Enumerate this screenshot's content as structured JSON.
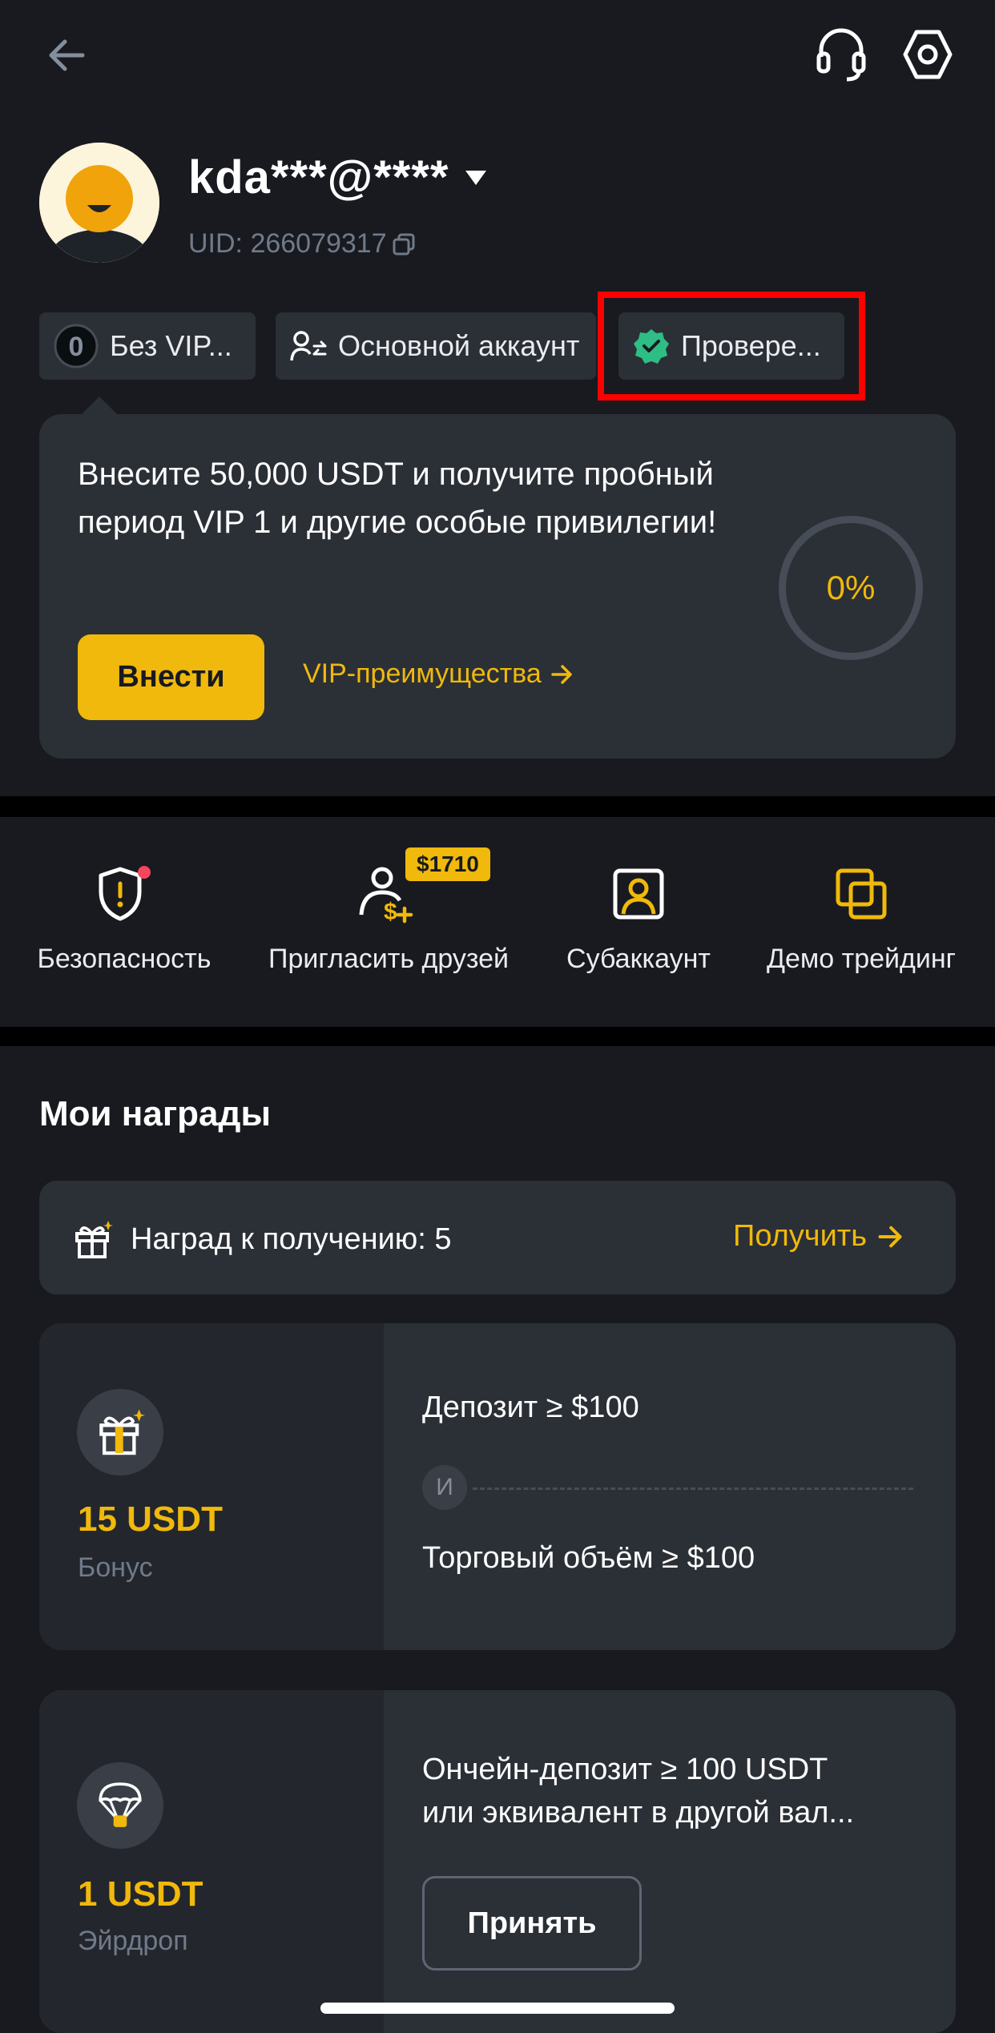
{
  "header": {
    "back_icon": "arrow-left-icon",
    "support_icon": "headset-icon",
    "settings_icon": "gear-hex-icon"
  },
  "profile": {
    "username": "kda***@****",
    "uid": "UID: 266079317"
  },
  "chips": {
    "vip": "Без VIP...",
    "vip_badge": "0",
    "account": "Основной аккаунт",
    "verified": "Провере..."
  },
  "promo": {
    "text": "Внесите 50,000 USDT и получите пробный период VIP 1 и другие особые привилегии!",
    "deposit_label": "Внести",
    "vip_link": "VIP-преимущества",
    "progress_label": "0%",
    "progress_value": 0
  },
  "quick_actions": {
    "security": "Безопасность",
    "invite": "Пригласить друзей",
    "invite_badge": "$1710",
    "subaccount": "Субаккаунт",
    "demo": "Демо трейдинг"
  },
  "rewards": {
    "title": "Мои награды",
    "pending_label": "Наград к получению: 5",
    "get_label": "Получить",
    "cards": [
      {
        "amount": "15 USDT",
        "type": "Бонус",
        "condition_1": "Депозит ≥ $100",
        "connector": "И",
        "condition_2": "Торговый объём ≥ $100"
      },
      {
        "amount": "1 USDT",
        "type": "Эйрдроп",
        "condition_1": "Ончейн-депозит ≥ 100 USDT",
        "condition_2": "или эквивалент в другой вал...",
        "accept_label": "Принять"
      }
    ]
  },
  "colors": {
    "background": "#181a20",
    "card": "#2b2f36",
    "accent": "#f0b90b",
    "verified": "#2ebd85",
    "highlight": "#ff0000"
  }
}
